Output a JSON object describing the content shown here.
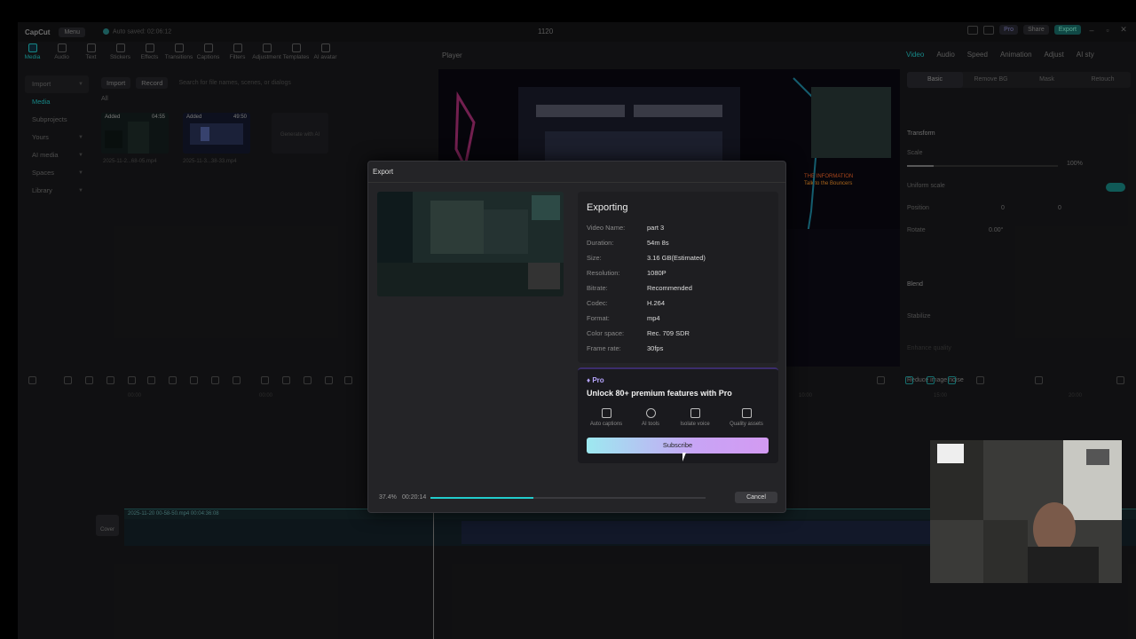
{
  "app": {
    "logo": "CapCut",
    "menu_label": "Menu",
    "autosave": "Auto saved: 02:06:12",
    "project_title": "1120",
    "pro_label": "Pro",
    "share_label": "Share",
    "export_label": "Export"
  },
  "toolbar": {
    "items": [
      "Media",
      "Audio",
      "Text",
      "Stickers",
      "Effects",
      "Transitions",
      "Captions",
      "Filters",
      "Adjustment",
      "Templates",
      "AI avatar"
    ]
  },
  "leftnav": {
    "items": [
      "Import",
      "Media",
      "Subprojects",
      "Yours",
      "AI media",
      "Spaces",
      "Library"
    ]
  },
  "media": {
    "import_label": "Import",
    "record_label": "Record",
    "search_placeholder": "Search for file names, scenes, or dialogs",
    "all_label": "All",
    "clips": [
      {
        "added": "Added",
        "duration": "04:55",
        "name": "2025-11-2...68-05.mp4"
      },
      {
        "added": "Added",
        "duration": "49:50",
        "name": "2025-11-3...38-33.mp4"
      }
    ],
    "generate_label": "Generate with AI"
  },
  "player": {
    "title": "Player"
  },
  "inspector": {
    "tabs": [
      "Video",
      "Audio",
      "Speed",
      "Animation",
      "Adjust",
      "AI sty"
    ],
    "subtabs": [
      "Basic",
      "Remove BG",
      "Mask",
      "Retouch"
    ],
    "transform_label": "Transform",
    "scale_label": "Scale",
    "scale_value": "100%",
    "uniform_scale_label": "Uniform scale",
    "position_label": "Position",
    "pos_x": "0",
    "pos_y": "0",
    "rotate_label": "Rotate",
    "rotate_value": "0.00°",
    "blend_label": "Blend",
    "stabilize_label": "Stabilize",
    "enhance_label": "Enhance quality",
    "reduce_noise_label": "Reduce image noise"
  },
  "timeline": {
    "ruler": [
      "00:00",
      "00:00",
      "10:00",
      "15:00",
      "20:00"
    ],
    "clip_label": "2025-11-20 00-58-50.mp4   00:04:36:08",
    "cover_label": "Cover"
  },
  "export_dialog": {
    "title": "Export",
    "status": "Exporting",
    "rows": [
      {
        "label": "Video Name:",
        "value": "part 3"
      },
      {
        "label": "Duration:",
        "value": "54m 8s"
      },
      {
        "label": "Size:",
        "value": "3.16 GB(Estimated)"
      },
      {
        "label": "Resolution:",
        "value": "1080P"
      },
      {
        "label": "Bitrate:",
        "value": "Recommended"
      },
      {
        "label": "Codec:",
        "value": "H.264"
      },
      {
        "label": "Format:",
        "value": "mp4"
      },
      {
        "label": "Color space:",
        "value": "Rec. 709 SDR"
      },
      {
        "label": "Frame rate:",
        "value": "30fps"
      }
    ],
    "pro": {
      "badge": "Pro",
      "headline": "Unlock 80+ premium features with Pro",
      "features": [
        "Auto captions",
        "AI tools",
        "Isolate voice",
        "Quality assets"
      ],
      "subscribe_label": "Subscribe"
    },
    "progress_percent_label": "37.4%",
    "progress_fraction": 0.374,
    "elapsed": "00:20:14",
    "cancel_label": "Cancel"
  },
  "colors": {
    "accent": "#22cccc",
    "pro": "#b8a6ff"
  }
}
